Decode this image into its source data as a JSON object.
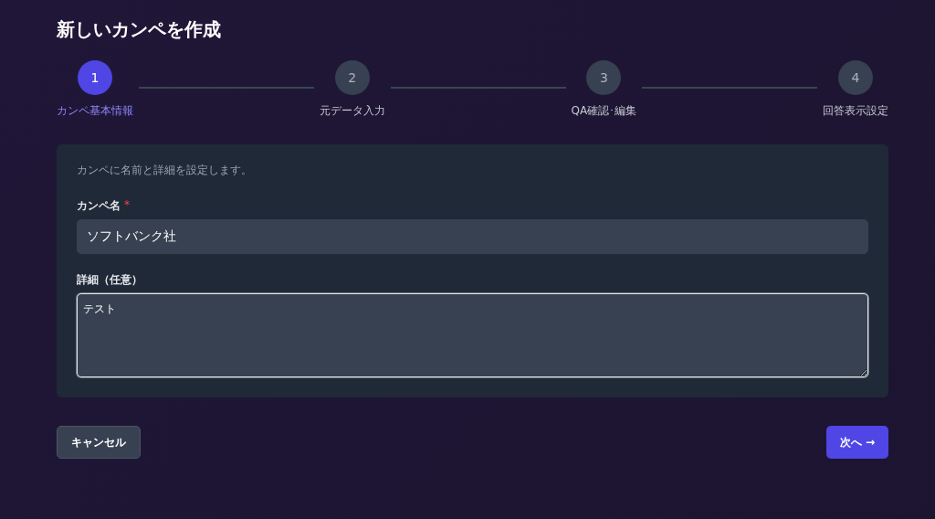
{
  "title": "新しいカンペを作成",
  "steps": [
    {
      "number": "1",
      "label": "カンペ基本情報",
      "selected": true
    },
    {
      "number": "2",
      "label": "元データ入力",
      "selected": false
    },
    {
      "number": "3",
      "label": "QA確認･編集",
      "selected": false
    },
    {
      "number": "4",
      "label": "回答表示設定",
      "selected": false
    }
  ],
  "form": {
    "description": "カンペに名前と詳細を設定します。",
    "fields": [
      {
        "kind": "input",
        "label": "カンペ名",
        "required_mark": "*",
        "value": "ソフトバンク社",
        "focused": false
      },
      {
        "kind": "textarea",
        "label": "詳細（任意）",
        "value": "テスト",
        "focused": true
      }
    ]
  },
  "buttons": [
    {
      "label": "キャンセル",
      "kind": "secondary"
    },
    {
      "label": "次へ →",
      "kind": "primary"
    }
  ]
}
